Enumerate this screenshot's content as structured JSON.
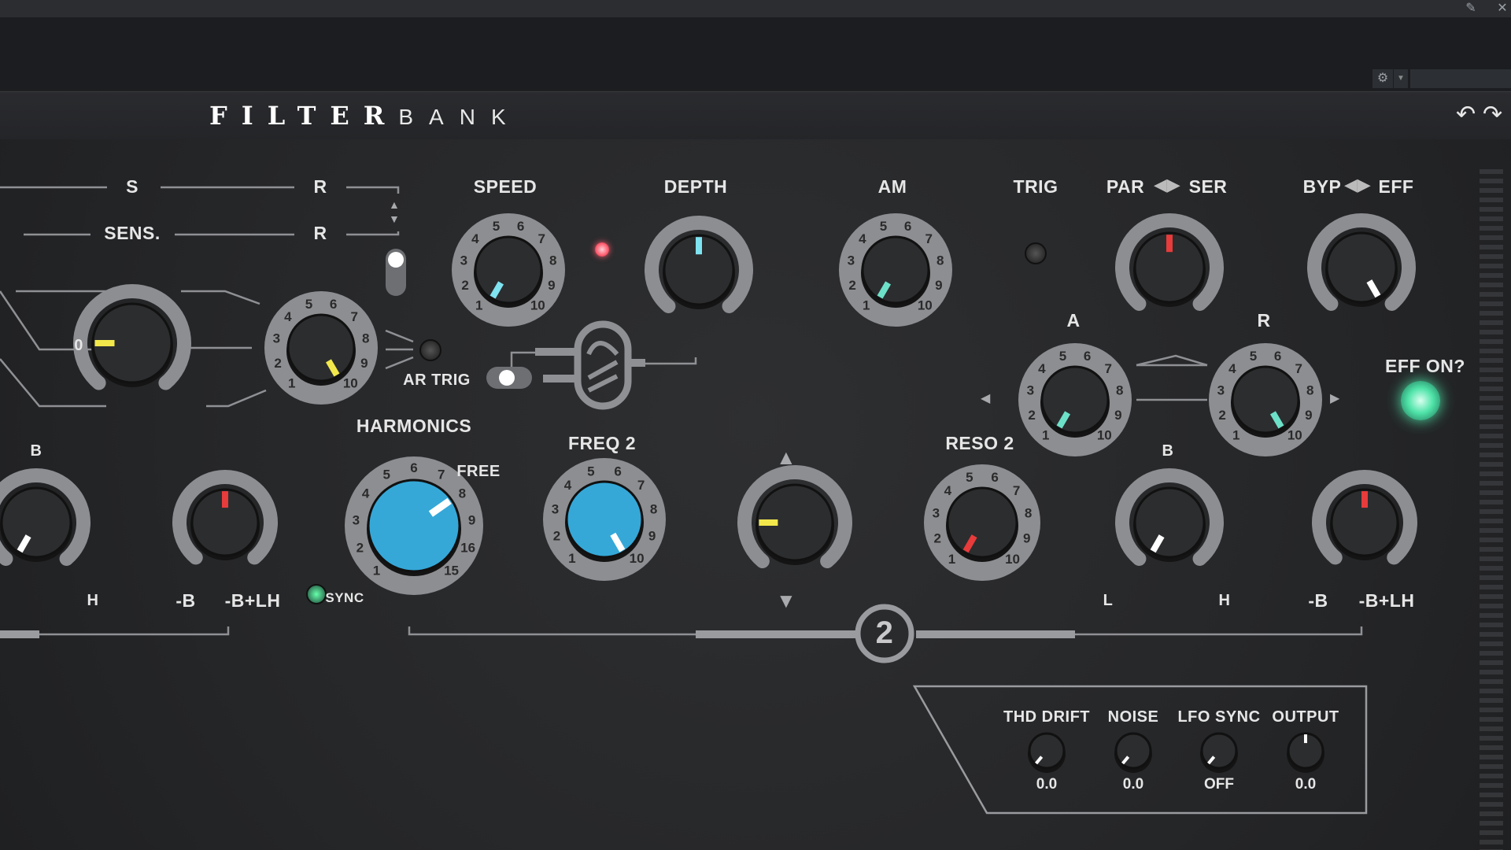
{
  "window": {
    "pin_icon": "pin-icon",
    "close_icon": "close-icon"
  },
  "host": {
    "settings_icon": "gear-icon"
  },
  "header": {
    "brand_bold": "FILTER",
    "brand_light": "BANK",
    "undo_icon": "undo-icon",
    "redo_icon": "redo-icon"
  },
  "labels": {
    "s": "S",
    "r1": "R",
    "sens": "SENS.",
    "r2": "R",
    "speed": "SPEED",
    "depth": "DEPTH",
    "am": "AM",
    "trig": "TRIG",
    "par": "PAR",
    "ser": "SER",
    "byp": "BYP",
    "eff": "EFF",
    "a": "A",
    "r3": "R",
    "eff_on": "EFF ON?",
    "ar_trig": "AR TRIG",
    "harmonics": "HARMONICS",
    "free": "FREE",
    "sync": "SYNC",
    "freq2": "FREQ 2",
    "reso2": "RESO 2",
    "zero": "0",
    "plus": "+",
    "minus": "−",
    "b_left": "B",
    "h_left": "H",
    "b_right": "B",
    "l_right": "L",
    "h_right": "H",
    "neg_b_left": "-B",
    "neg_blh_left": "-B+LH",
    "neg_b_right": "-B",
    "neg_blh_right": "-B+LH",
    "section_num": "2"
  },
  "dial_numbers": [
    "1",
    "2",
    "3",
    "4",
    "5",
    "6",
    "7",
    "8",
    "9",
    "10"
  ],
  "harmonics_numbers": [
    "1",
    "2",
    "3",
    "4",
    "5",
    "6",
    "7",
    "8",
    "9",
    "16",
    "15"
  ],
  "knobs": {
    "speed": {
      "pointer_color": "#7fe3f0"
    },
    "depth": {
      "pointer_color": "#7fe3f0"
    },
    "am": {
      "pointer_color": "#6de0c8"
    },
    "sens": {
      "pointer_color": "#f2e84b"
    },
    "offset": {
      "pointer_color": "#f2e84b"
    },
    "a": {
      "pointer_color": "#6de0c8"
    },
    "r": {
      "pointer_color": "#6de0c8"
    },
    "par_ser": {
      "pointer_color": "#e83b3b"
    },
    "byp_eff": {
      "pointer_color": "#ffffff"
    },
    "harmonics": {
      "pointer_color": "#ffffff",
      "cap_color": "#35a8d8"
    },
    "freq2": {
      "pointer_color": "#ffffff",
      "cap_color": "#35a8d8"
    },
    "reso2": {
      "pointer_color": "#e83b3b"
    },
    "balance_left": {
      "pointer_color": "#e83b3b"
    },
    "balance_right": {
      "pointer_color": "#e83b3b"
    },
    "filter_left": {
      "pointer_color": "#ffffff"
    },
    "filter_right": {
      "pointer_color": "#ffffff"
    },
    "pan2": {
      "pointer_color": "#f2e84b"
    }
  },
  "bottom_box": {
    "items": [
      {
        "label": "THD DRIFT",
        "value": "0.0"
      },
      {
        "label": "NOISE",
        "value": "0.0"
      },
      {
        "label": "LFO SYNC",
        "value": "OFF"
      },
      {
        "label": "OUTPUT",
        "value": "0.0"
      }
    ]
  },
  "colors": {
    "accent_blue": "#35a8d8",
    "led_red": "#ff5b6e",
    "led_green": "#4fe3a8",
    "panel": "#262729"
  }
}
